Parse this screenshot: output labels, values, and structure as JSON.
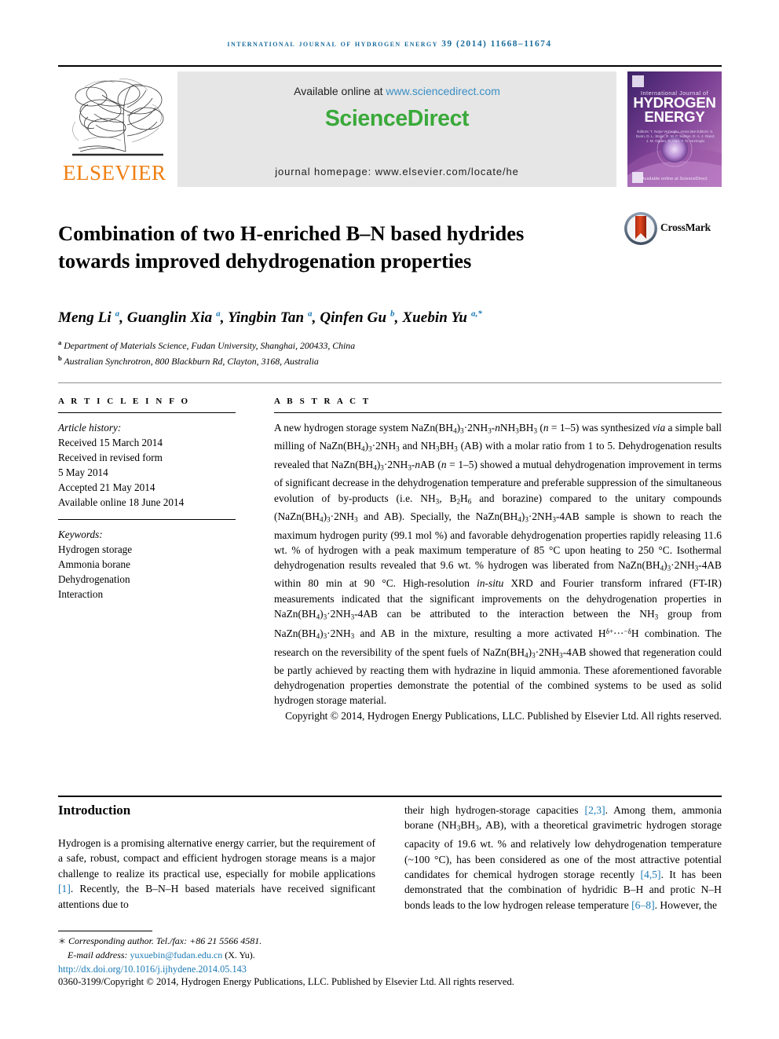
{
  "running_head": "International Journal of Hydrogen Energy 39 (2014) 11668–11674",
  "masthead": {
    "publisher_logo_text": "ELSEVIER",
    "publisher_logo_icon": "elsevier-tree-logo",
    "available_prefix": "Available online at ",
    "available_url": "www.sciencedirect.com",
    "sciencedirect_wordmark": "ScienceDirect",
    "homepage_line": "journal homepage: www.elsevier.com/locate/he",
    "cover": {
      "small_title": "International Journal of",
      "big_title_line1": "HYDROGEN",
      "big_title_line2": "ENERGY",
      "editors": "Editors: T. Nejat Veziroglu, Associate Editors: S. Dunn, D. L. Stojic, D. M. F. Santos, D. A. J. Rand, J. M. Ogden, D. Hart, T. N. Veziroglu",
      "bottom_text": "Available online at ScienceDirect"
    },
    "colors": {
      "band_bg": "#e6e6e6",
      "sciencedirect_green": "#3AA93A",
      "link_blue": "#3a8ec4",
      "elsevier_orange": "#F07F13",
      "running_head_blue": "#1a6c9c"
    }
  },
  "article": {
    "title": "Combination of two H-enriched B–N based hydrides towards improved dehydrogenation properties",
    "crossmark_label": "CrossMark",
    "crossmark_icon": "crossmark-logo",
    "authors": [
      {
        "name": "Meng Li",
        "sup": "a"
      },
      {
        "name": "Guanglin Xia",
        "sup": "a"
      },
      {
        "name": "Yingbin Tan",
        "sup": "a"
      },
      {
        "name": "Qinfen Gu",
        "sup": "b"
      },
      {
        "name": "Xuebin Yu",
        "sup": "a,*"
      }
    ],
    "affiliations": [
      {
        "marker": "a",
        "text": "Department of Materials Science, Fudan University, Shanghai, 200433, China"
      },
      {
        "marker": "b",
        "text": "Australian Synchrotron, 800 Blackburn Rd, Clayton, 3168, Australia"
      }
    ]
  },
  "article_info": {
    "heading": "A R T I C L E   I N F O",
    "history_label": "Article history:",
    "history": [
      "Received 15 March 2014",
      "Received in revised form",
      "5 May 2014",
      "Accepted 21 May 2014",
      "Available online 18 June 2014"
    ],
    "keywords_label": "Keywords:",
    "keywords": [
      "Hydrogen storage",
      "Ammonia borane",
      "Dehydrogenation",
      "Interaction"
    ]
  },
  "abstract": {
    "heading": "A B S T R A C T",
    "paragraph_html": "A new hydrogen storage system NaZn(BH<sub>4</sub>)<sub>3</sub>·2NH<sub>3</sub>-<i class=\"it\">n</i>NH<sub>3</sub>BH<sub>3</sub> (<i class=\"it\">n</i> = 1–5) was synthesized <i class=\"it\">via</i> a simple ball milling of NaZn(BH<sub>4</sub>)<sub>3</sub>·2NH<sub>3</sub> and NH<sub>3</sub>BH<sub>3</sub> (AB) with a molar ratio from 1 to 5. Dehydrogenation results revealed that NaZn(BH<sub>4</sub>)<sub>3</sub>·2NH<sub>3</sub>-<i class=\"it\">n</i>AB (<i class=\"it\">n</i> = 1–5) showed a mutual dehydrogenation improvement in terms of significant decrease in the dehydrogenation temperature and preferable suppression of the simultaneous evolution of by-products (i.e. NH<sub>3</sub>, B<sub>2</sub>H<sub>6</sub> and borazine) compared to the unitary compounds (NaZn(BH<sub>4</sub>)<sub>3</sub>·2NH<sub>3</sub> and AB). Specially, the NaZn(BH<sub>4</sub>)<sub>3</sub>·2NH<sub>3</sub>-4AB sample is shown to reach the maximum hydrogen purity (99.1 mol %) and favorable dehydrogenation properties rapidly releasing 11.6 wt. % of hydrogen with a peak maximum temperature of 85 °C upon heating to 250 °C. Isothermal dehydrogenation results revealed that 9.6 wt. % hydrogen was liberated from NaZn(BH<sub>4</sub>)<sub>3</sub>·2NH<sub>3</sub>-4AB within 80 min at 90 °C. High-resolution <i class=\"it\">in-situ</i> XRD and Fourier transform infrared (FT-IR) measurements indicated that the significant improvements on the dehydrogenation properties in NaZn(BH<sub>4</sub>)<sub>3</sub>·2NH<sub>3</sub>-4AB can be attributed to the interaction between the NH<sub>3</sub> group from NaZn(BH<sub>4</sub>)<sub>3</sub>·2NH<sub>3</sub> and AB in the mixture, resulting a more activated H<sup class=\"chem\">δ+</sup>···<sup class=\"chem\">−δ</sup>H combination. The research on the reversibility of the spent fuels of NaZn(BH<sub>4</sub>)<sub>3</sub>·2NH<sub>3</sub>-4AB showed that regeneration could be partly achieved by reacting them with hydrazine in liquid ammonia. These aforementioned favorable dehydrogenation properties demonstrate the potential of the combined systems to be used as solid hydrogen storage material.",
    "copyright": "Copyright © 2014, Hydrogen Energy Publications, LLC. Published by Elsevier Ltd. All rights reserved."
  },
  "body": {
    "section_heading": "Introduction",
    "left_column_html": "Hydrogen is a promising alternative energy carrier, but the requirement of a safe, robust, compact and efficient hydrogen storage means is a major challenge to realize its practical use, especially for mobile applications <span class=\"ref\">[1]</span>. Recently, the B–N–H based materials have received significant attentions due to",
    "right_column_html": "their high hydrogen-storage capacities <span class=\"ref\">[2,3]</span>. Among them, ammonia borane (NH<sub>3</sub>BH<sub>3</sub>, AB), with a theoretical gravimetric hydrogen storage capacity of 19.6 wt. % and relatively low dehydrogenation temperature (~100 °C), has been considered as one of the most attractive potential candidates for chemical hydrogen storage recently <span class=\"ref\">[4,5]</span>. It has been demonstrated that the combination of hydridic B–H and protic N–H bonds leads to the low hydrogen release temperature <span class=\"ref\">[6–8]</span>. However, the"
  },
  "footer": {
    "corresponding_author": "Corresponding author. Tel./fax: +86 21 5566 4581.",
    "email_label": "E-mail address:",
    "email": "yuxuebin@fudan.edu.cn",
    "email_attrib": "(X. Yu).",
    "doi": "http://dx.doi.org/10.1016/j.ijhydene.2014.05.143",
    "issn_line": "0360-3199/Copyright © 2014, Hydrogen Energy Publications, LLC. Published by Elsevier Ltd. All rights reserved."
  }
}
